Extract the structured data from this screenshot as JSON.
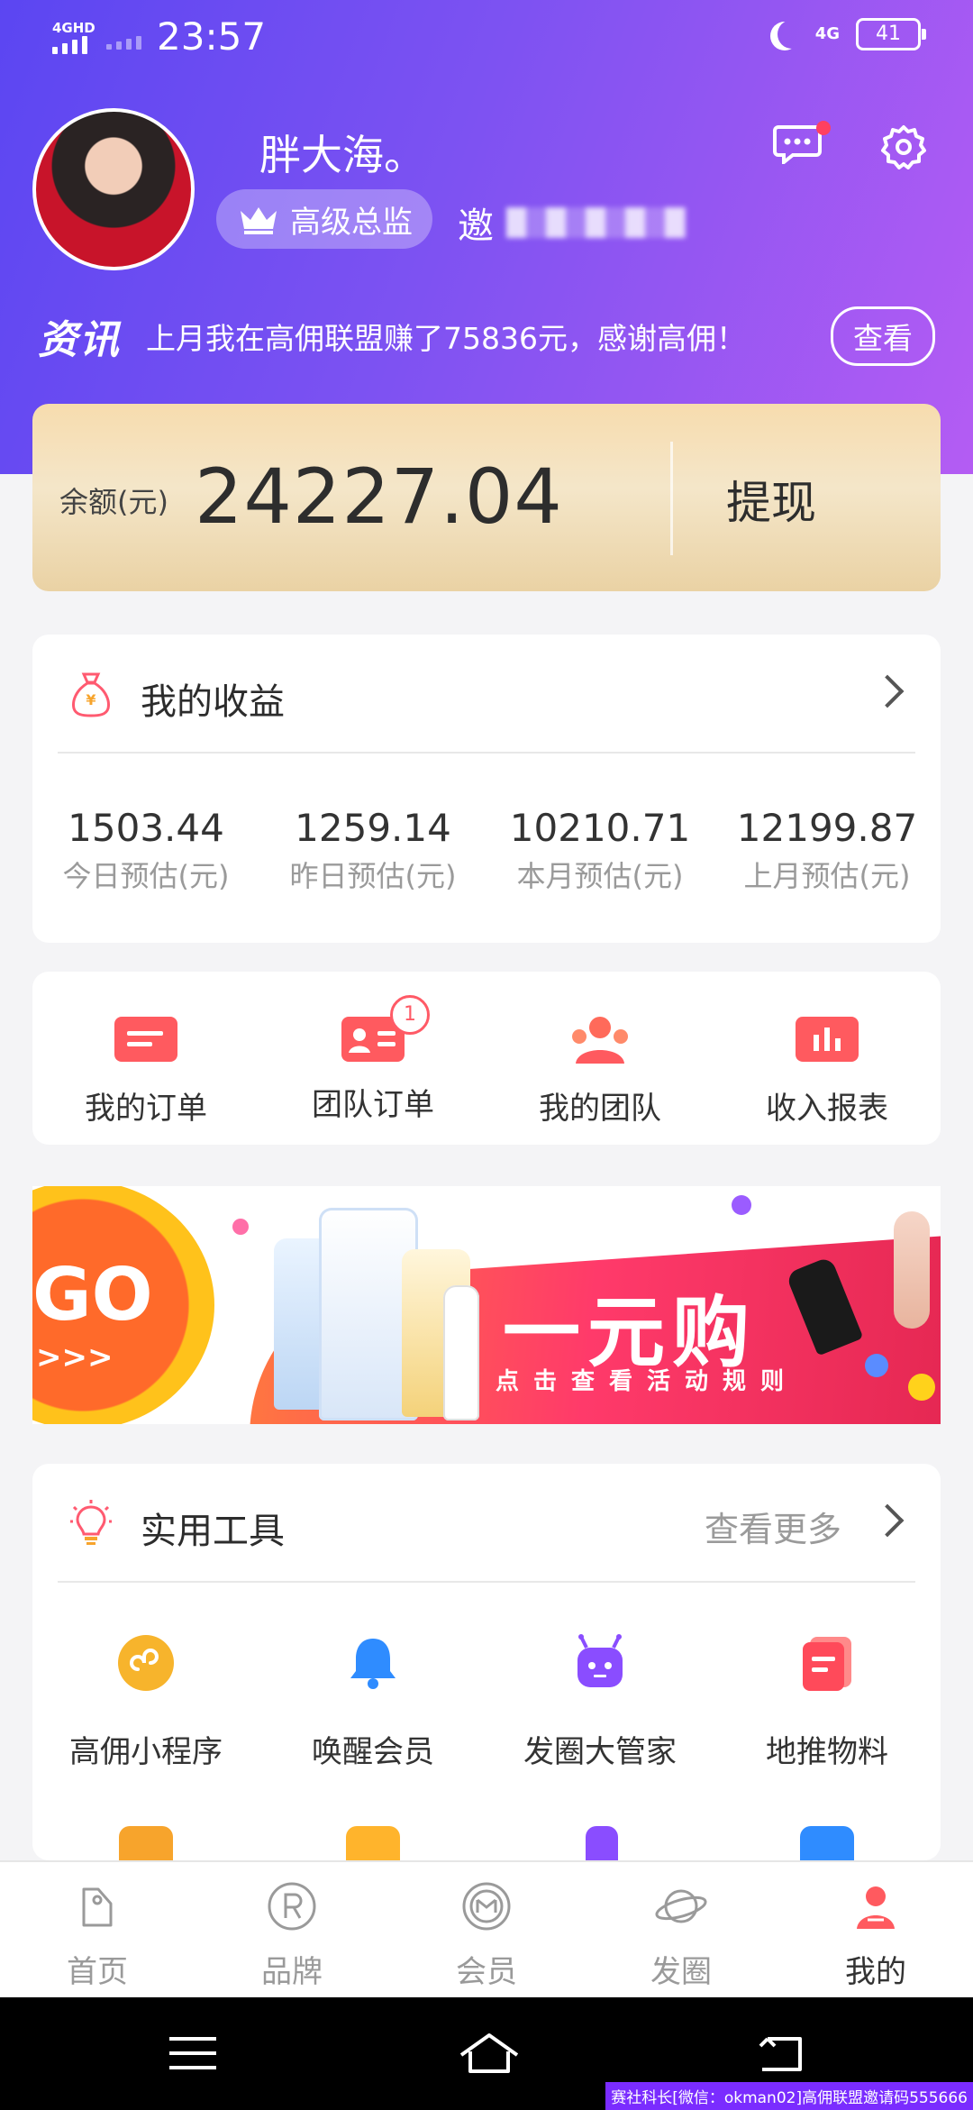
{
  "status_bar": {
    "network": "4GHD",
    "time": "23:57",
    "network_right": "4G",
    "battery": "41"
  },
  "profile": {
    "username": "胖大海。",
    "level": "高级总监",
    "invite_prefix": "邀"
  },
  "news": {
    "tag": "资讯",
    "text": "上月我在高佣联盟赚了75836元，感谢高佣！",
    "view_button": "查看"
  },
  "balance": {
    "label": "余额(元)",
    "value": "24227.04",
    "withdraw": "提现"
  },
  "earnings": {
    "title": "我的收益",
    "items": [
      {
        "value": "1503.44",
        "label": "今日预估(元)"
      },
      {
        "value": "1259.14",
        "label": "昨日预估(元)"
      },
      {
        "value": "10210.71",
        "label": "本月预估(元)"
      },
      {
        "value": "12199.87",
        "label": "上月预估(元)"
      }
    ]
  },
  "shortcuts": {
    "items": [
      {
        "label": "我的订单",
        "icon": "order-icon"
      },
      {
        "label": "团队订单",
        "icon": "team-order-icon",
        "badge": "1"
      },
      {
        "label": "我的团队",
        "icon": "team-icon"
      },
      {
        "label": "收入报表",
        "icon": "report-icon"
      }
    ]
  },
  "banner": {
    "go_text": "GO",
    "arrows": ">>>",
    "title": "一元购",
    "subtitle": "点击查看活动规则"
  },
  "tools": {
    "title": "实用工具",
    "more": "查看更多",
    "items": [
      {
        "label": "高佣小程序",
        "icon": "mini-program-icon",
        "color": "#f7b42c"
      },
      {
        "label": "唤醒会员",
        "icon": "bell-icon",
        "color": "#2f8cff"
      },
      {
        "label": "发圈大管家",
        "icon": "robot-icon",
        "color": "#8a4dff"
      },
      {
        "label": "地推物料",
        "icon": "material-icon",
        "color": "#ff4a5a"
      }
    ]
  },
  "tabbar": {
    "items": [
      {
        "label": "首页",
        "icon": "tag-icon"
      },
      {
        "label": "品牌",
        "icon": "brand-icon"
      },
      {
        "label": "会员",
        "icon": "member-icon"
      },
      {
        "label": "发圈",
        "icon": "planet-icon"
      },
      {
        "label": "我的",
        "icon": "user-icon",
        "active": true
      }
    ]
  },
  "watermark": "赛社科长[微信：okman02]高佣联盟邀请码555666",
  "colors": {
    "accent": "#6a4cf3",
    "red": "#ff4a5a",
    "gold": "#f4e0b8"
  }
}
